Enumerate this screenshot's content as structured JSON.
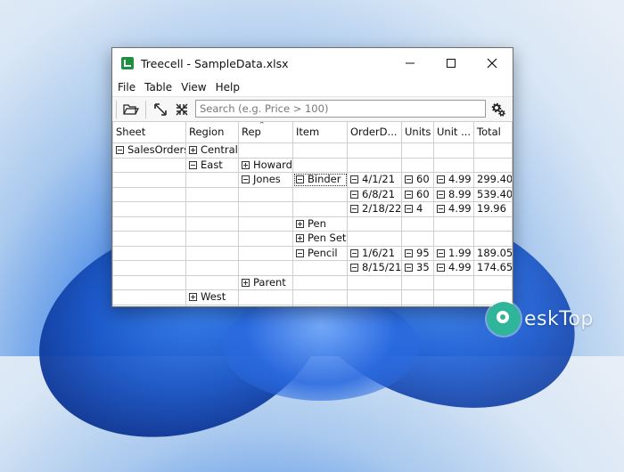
{
  "window": {
    "title": "Treecell - SampleData.xlsx"
  },
  "menu": [
    "File",
    "Table",
    "View",
    "Help"
  ],
  "toolbar": {
    "search_placeholder": "Search (e.g. Price > 100)"
  },
  "columns": [
    "Sheet",
    "Region",
    "Rep",
    "Item",
    "OrderD...",
    "Units",
    "Unit ...",
    "Total"
  ],
  "rows": [
    {
      "sheet": "SalesOrders",
      "sheet_tog": "minus",
      "region": "Central",
      "region_tog": "plus",
      "rep": "",
      "item": "",
      "date": "",
      "units": "",
      "unit": "",
      "total": ""
    },
    {
      "sheet": "",
      "region": "East",
      "region_tog": "minus",
      "rep": "Howard",
      "rep_tog": "plus",
      "item": "",
      "date": "",
      "units": "",
      "unit": "",
      "total": ""
    },
    {
      "sheet": "",
      "region": "",
      "rep": "Jones",
      "rep_tog": "minus",
      "item": "Binder",
      "item_tog": "minus",
      "date": "4/1/21",
      "units": "60",
      "unit": "4.99",
      "total": "299.40",
      "selected": true
    },
    {
      "sheet": "",
      "region": "",
      "rep": "",
      "item": "",
      "date": "6/8/21",
      "units": "60",
      "unit": "8.99",
      "total": "539.40"
    },
    {
      "sheet": "",
      "region": "",
      "rep": "",
      "item": "",
      "date": "2/18/22",
      "units": "4",
      "unit": "4.99",
      "total": "19.96"
    },
    {
      "sheet": "",
      "region": "",
      "rep": "",
      "item": "Pen",
      "item_tog": "plus",
      "date": "",
      "units": "",
      "unit": "",
      "total": ""
    },
    {
      "sheet": "",
      "region": "",
      "rep": "",
      "item": "Pen Set",
      "item_tog": "plus",
      "date": "",
      "units": "",
      "unit": "",
      "total": ""
    },
    {
      "sheet": "",
      "region": "",
      "rep": "",
      "item": "Pencil",
      "item_tog": "minus",
      "date": "1/6/21",
      "units": "95",
      "unit": "1.99",
      "total": "189.05"
    },
    {
      "sheet": "",
      "region": "",
      "rep": "",
      "item": "",
      "date": "8/15/21",
      "units": "35",
      "unit": "4.99",
      "total": "174.65"
    },
    {
      "sheet": "",
      "region": "",
      "rep": "Parent",
      "rep_tog": "plus",
      "item": "",
      "date": "",
      "units": "",
      "unit": "",
      "total": ""
    },
    {
      "sheet": "",
      "region": "West",
      "region_tog": "plus",
      "rep": "",
      "item": "",
      "date": "",
      "units": "",
      "unit": "",
      "total": ""
    },
    {
      "sheet": "",
      "region": "",
      "rep": "",
      "item": "",
      "date": "",
      "units": "",
      "unit": "",
      "total": ""
    }
  ],
  "watermark": {
    "text": "eskTop"
  },
  "colors": {
    "accent": "#1e8f3e",
    "grid": "#cfcfcf"
  }
}
